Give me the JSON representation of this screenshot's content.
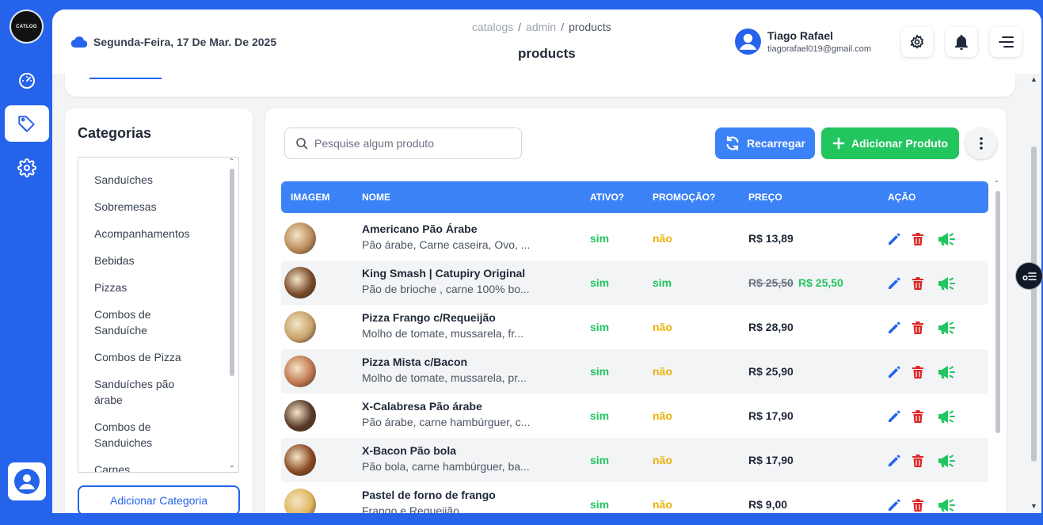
{
  "brand": {
    "logo_text": "CATLOG"
  },
  "header": {
    "date": "Segunda-Feira, 17 De Mar. De 2025",
    "breadcrumb": [
      "catalogs",
      "admin",
      "products"
    ],
    "breadcrumb_sep": "/",
    "title": "products",
    "user_name": "Tiago Rafael",
    "user_email": "tiagorafael019@gmail.com"
  },
  "sidebar": {
    "items": [
      {
        "icon": "dashboard-icon",
        "active": false
      },
      {
        "icon": "tag-icon",
        "active": true
      },
      {
        "icon": "gear-icon",
        "active": false
      }
    ]
  },
  "categories": {
    "title": "Categorias",
    "items": [
      "Sanduíches",
      "Sobremesas",
      "Acompanhamentos",
      "Bebidas",
      "Pizzas",
      "Combos de Sanduíche",
      "Combos de Pizza",
      "Sanduíches pão árabe",
      "Combos de Sanduiches",
      "Carnes"
    ],
    "add_button": "Adicionar Categoria"
  },
  "products": {
    "search_placeholder": "Pesquise algum produto",
    "reload_label": "Recarregar",
    "add_label": "Adicionar Produto",
    "columns": [
      "IMAGEM",
      "NOME",
      "ATIVO?",
      "PROMOÇÃO?",
      "PREÇO",
      "AÇÃO"
    ],
    "rows": [
      {
        "name": "Americano Pão Árabe",
        "desc": "Pão árabe, Carne caseira, Ovo, ...",
        "active": "sim",
        "promo": "não",
        "price": "R$ 13,89",
        "old_price": "",
        "img": "#b98a5a"
      },
      {
        "name": "King Smash | Catupiry Original",
        "desc": "Pão de brioche , carne 100% bo...",
        "active": "sim",
        "promo": "sim",
        "price": "R$ 25,50",
        "old_price": "R$ 25,50",
        "img": "#7a4a2a"
      },
      {
        "name": "Pizza Frango c/Requeijão",
        "desc": "Molho de tomate, mussarela, fr...",
        "active": "sim",
        "promo": "não",
        "price": "R$ 28,90",
        "old_price": "",
        "img": "#c9a26b"
      },
      {
        "name": "Pizza Mista c/Bacon",
        "desc": "Molho de tomate, mussarela, pr...",
        "active": "sim",
        "promo": "não",
        "price": "R$ 25,90",
        "old_price": "",
        "img": "#c07850"
      },
      {
        "name": "X-Calabresa Pão árabe",
        "desc": "Pão árabe, carne hambúrguer, c...",
        "active": "sim",
        "promo": "não",
        "price": "R$ 17,90",
        "old_price": "",
        "img": "#5a3a2a"
      },
      {
        "name": "X-Bacon Pão bola",
        "desc": "Pão bola, carne hambúrguer, ba...",
        "active": "sim",
        "promo": "não",
        "price": "R$ 17,90",
        "old_price": "",
        "img": "#8a4a24"
      },
      {
        "name": "Pastel de forno de frango",
        "desc": "Frango e Requeijão",
        "active": "sim",
        "promo": "não",
        "price": "R$ 9,00",
        "old_price": "",
        "img": "#e0b860"
      }
    ]
  },
  "colors": {
    "primary": "#2563eb",
    "header_blue": "#3b82f6",
    "success": "#22c55e",
    "warning": "#eab308",
    "danger": "#dc2626"
  }
}
